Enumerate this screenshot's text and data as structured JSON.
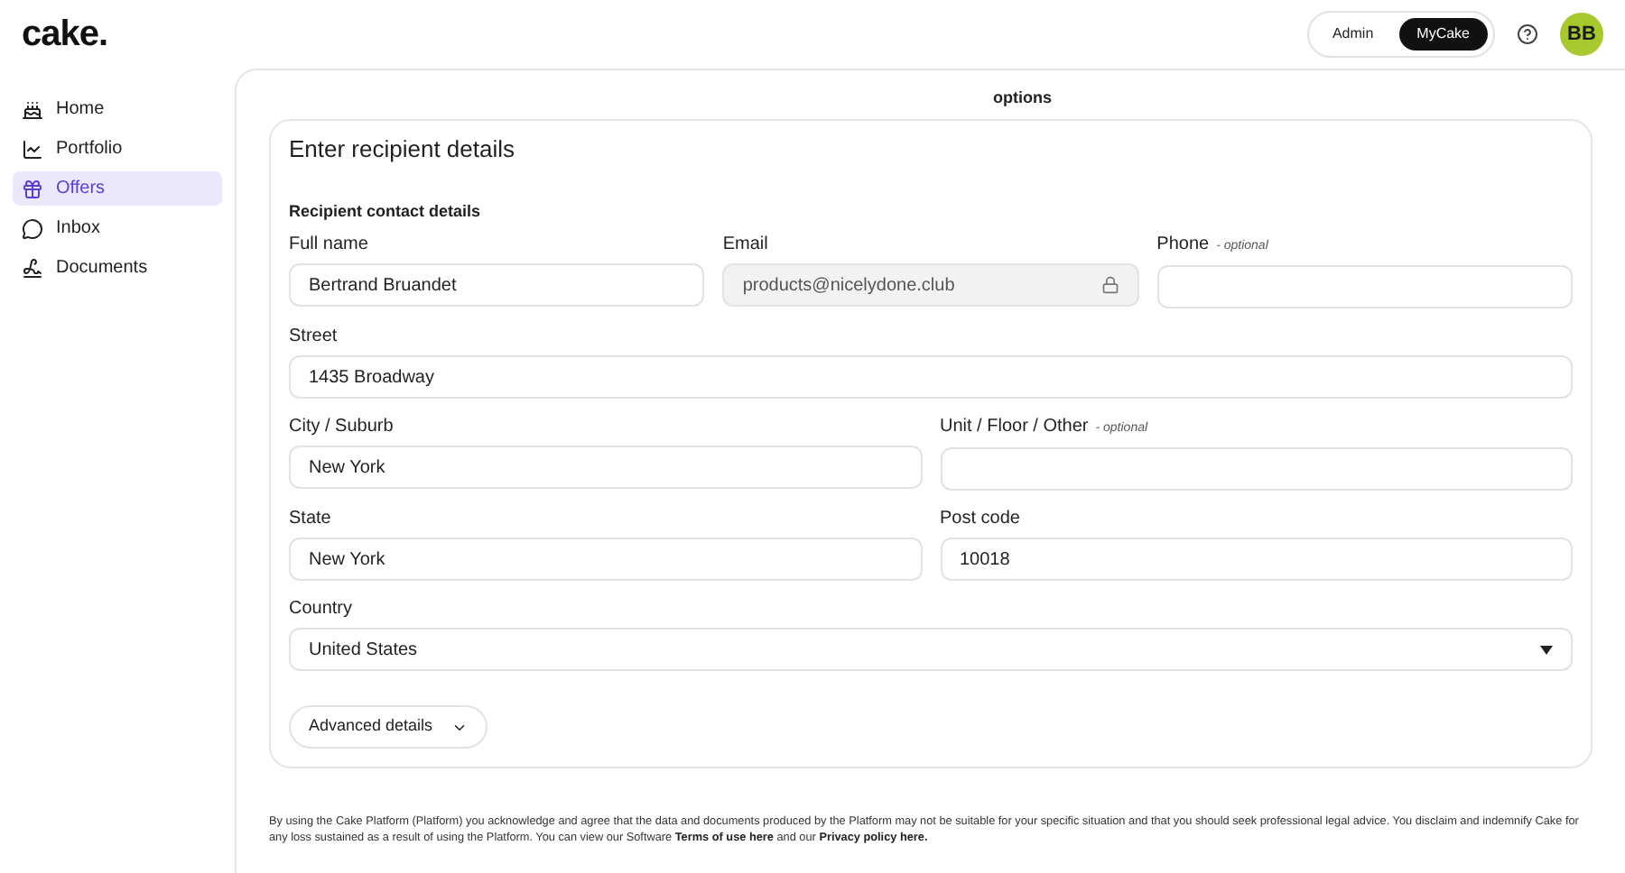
{
  "logo": "cake.",
  "header": {
    "switch": [
      {
        "label": "Admin",
        "selected": false
      },
      {
        "label": "MyCake",
        "selected": true
      }
    ],
    "avatar": "BB"
  },
  "sidebar": {
    "items": [
      {
        "label": "Home",
        "selected": false
      },
      {
        "label": "Portfolio",
        "selected": false
      },
      {
        "label": "Offers",
        "selected": true
      },
      {
        "label": "Inbox",
        "selected": false
      },
      {
        "label": "Documents",
        "selected": false
      }
    ]
  },
  "stepper": {
    "visible_label": "options"
  },
  "form": {
    "title": "Enter recipient details",
    "section": "Recipient contact details",
    "rows": [
      [
        {
          "kind": "text",
          "label": "Full name",
          "value": "Bertrand Bruandet"
        },
        {
          "kind": "locked",
          "label": "Email",
          "value": "products@nicelydone.club"
        },
        {
          "kind": "text",
          "label": "Phone",
          "note": "- optional"
        }
      ],
      [
        {
          "kind": "text",
          "label": "Street",
          "value": "1435 Broadway"
        }
      ],
      [
        {
          "kind": "text",
          "label": "City / Suburb",
          "value": "New York"
        },
        {
          "kind": "text",
          "label": "Unit / Floor / Other",
          "note": "- optional"
        }
      ],
      [
        {
          "kind": "text",
          "label": "State",
          "value": "New York"
        },
        {
          "kind": "text",
          "label": "Post code",
          "value": "10018"
        }
      ],
      [
        {
          "kind": "select",
          "label": "Country",
          "value": "United States"
        }
      ]
    ],
    "advanced_button": "Advanced details"
  },
  "footer": {
    "text": "By using the Cake Platform (Platform) you acknowledge and agree that the data and documents produced by the Platform may not be suitable for your specific situation and that you should seek professional legal advice. You disclaim and indemnify Cake for any loss sustained as a result of using the Platform. You can view our Software",
    "links": [
      "Terms of use here",
      "Privacy policy here."
    ],
    "between": "and our"
  }
}
